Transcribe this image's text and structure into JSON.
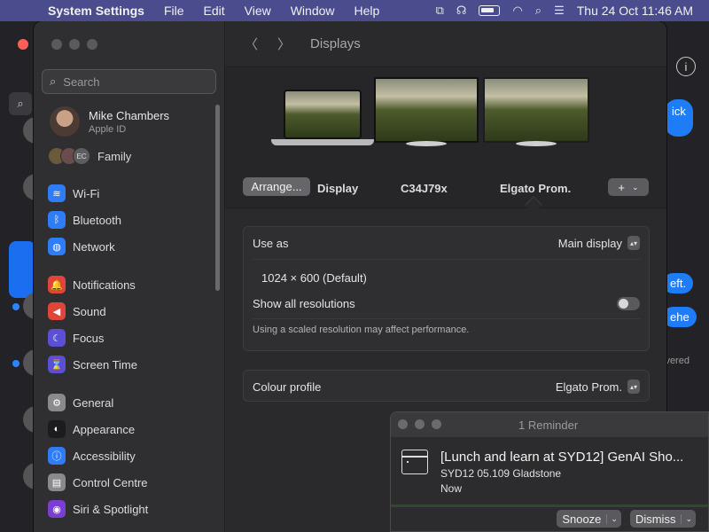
{
  "menubar": {
    "app": "System Settings",
    "items": [
      "File",
      "Edit",
      "View",
      "Window",
      "Help"
    ],
    "clock": "Thu 24 Oct  11:46 AM"
  },
  "background": {
    "bubbles": [
      "ick",
      "eft.",
      "ehe"
    ],
    "delivered": "ivered"
  },
  "sidebar": {
    "search_placeholder": "Search",
    "profile": {
      "name": "Mike Chambers",
      "sub": "Apple ID"
    },
    "family": {
      "label": "Family",
      "badge": "EC"
    },
    "groups": [
      [
        {
          "label": "Wi-Fi",
          "icon": "wifi-icon",
          "color": "#2f7df6",
          "glyph": "≋"
        },
        {
          "label": "Bluetooth",
          "icon": "bluetooth-icon",
          "color": "#2f7df6",
          "glyph": "ᛒ"
        },
        {
          "label": "Network",
          "icon": "network-icon",
          "color": "#2f7df6",
          "glyph": "◍"
        }
      ],
      [
        {
          "label": "Notifications",
          "icon": "notifications-icon",
          "color": "#e0453a",
          "glyph": "🔔"
        },
        {
          "label": "Sound",
          "icon": "sound-icon",
          "color": "#e0453a",
          "glyph": "◀"
        },
        {
          "label": "Focus",
          "icon": "focus-icon",
          "color": "#5b4fd6",
          "glyph": "☾"
        },
        {
          "label": "Screen Time",
          "icon": "screen-time-icon",
          "color": "#5b4fd6",
          "glyph": "⌛"
        }
      ],
      [
        {
          "label": "General",
          "icon": "general-icon",
          "color": "#8a8a8e",
          "glyph": "⚙"
        },
        {
          "label": "Appearance",
          "icon": "appearance-icon",
          "color": "#1c1c1e",
          "glyph": "◐"
        },
        {
          "label": "Accessibility",
          "icon": "accessibility-icon",
          "color": "#2f7df6",
          "glyph": "ⓘ"
        },
        {
          "label": "Control Centre",
          "icon": "control-centre-icon",
          "color": "#8a8a8e",
          "glyph": "▤"
        },
        {
          "label": "Siri & Spotlight",
          "icon": "siri-icon",
          "color": "#7a3fd0",
          "glyph": "◉"
        }
      ]
    ]
  },
  "main": {
    "title": "Displays",
    "monitors": [
      {
        "label": "Display",
        "kind": "laptop"
      },
      {
        "label": "C34J79x",
        "kind": "external"
      },
      {
        "label": "Elgato Prom.",
        "kind": "external"
      }
    ],
    "arrange_label": "Arrange...",
    "add_label": "+",
    "use_as": {
      "label": "Use as",
      "value": "Main display"
    },
    "resolution": "1024 × 600 (Default)",
    "show_all": {
      "label": "Show all resolutions",
      "on": false
    },
    "note": "Using a scaled resolution may affect performance.",
    "colour_profile": {
      "label": "Colour profile",
      "value": "Elgato Prom."
    }
  },
  "reminder": {
    "title": "1 Reminder",
    "heading": "[Lunch and learn at SYD12] GenAI Sho...",
    "location": "SYD12 05.109 Gladstone",
    "when": "Now",
    "snooze": "Snooze",
    "dismiss": "Dismiss"
  }
}
